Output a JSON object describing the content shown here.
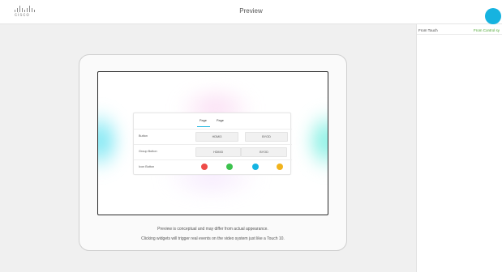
{
  "header": {
    "logo_text": "cisco",
    "title": "Preview"
  },
  "side_panel": {
    "col_touch": "From Touch",
    "col_control": "From Control sy"
  },
  "preview": {
    "tabs": [
      {
        "label": "Page"
      },
      {
        "label": "Page"
      }
    ],
    "rows": [
      {
        "label": "Button",
        "buttons": [
          "HDMI3",
          "BYOD"
        ]
      },
      {
        "label": "Group Button",
        "buttons": [
          "HDMI3",
          "BYOD"
        ]
      },
      {
        "label": "Icon Button",
        "icon_colors": [
          "#ee4b47",
          "#3cc24e",
          "#14b4e2",
          "#f1b31c"
        ]
      }
    ]
  },
  "caption": {
    "line1": "Preview is conceptual and may differ from actual appearance.",
    "line2": "Clicking widgets will trigger real events on the video system just like a Touch 10."
  },
  "colors": {
    "accent": "#16b3e0",
    "control_column": "#4aa52e"
  }
}
